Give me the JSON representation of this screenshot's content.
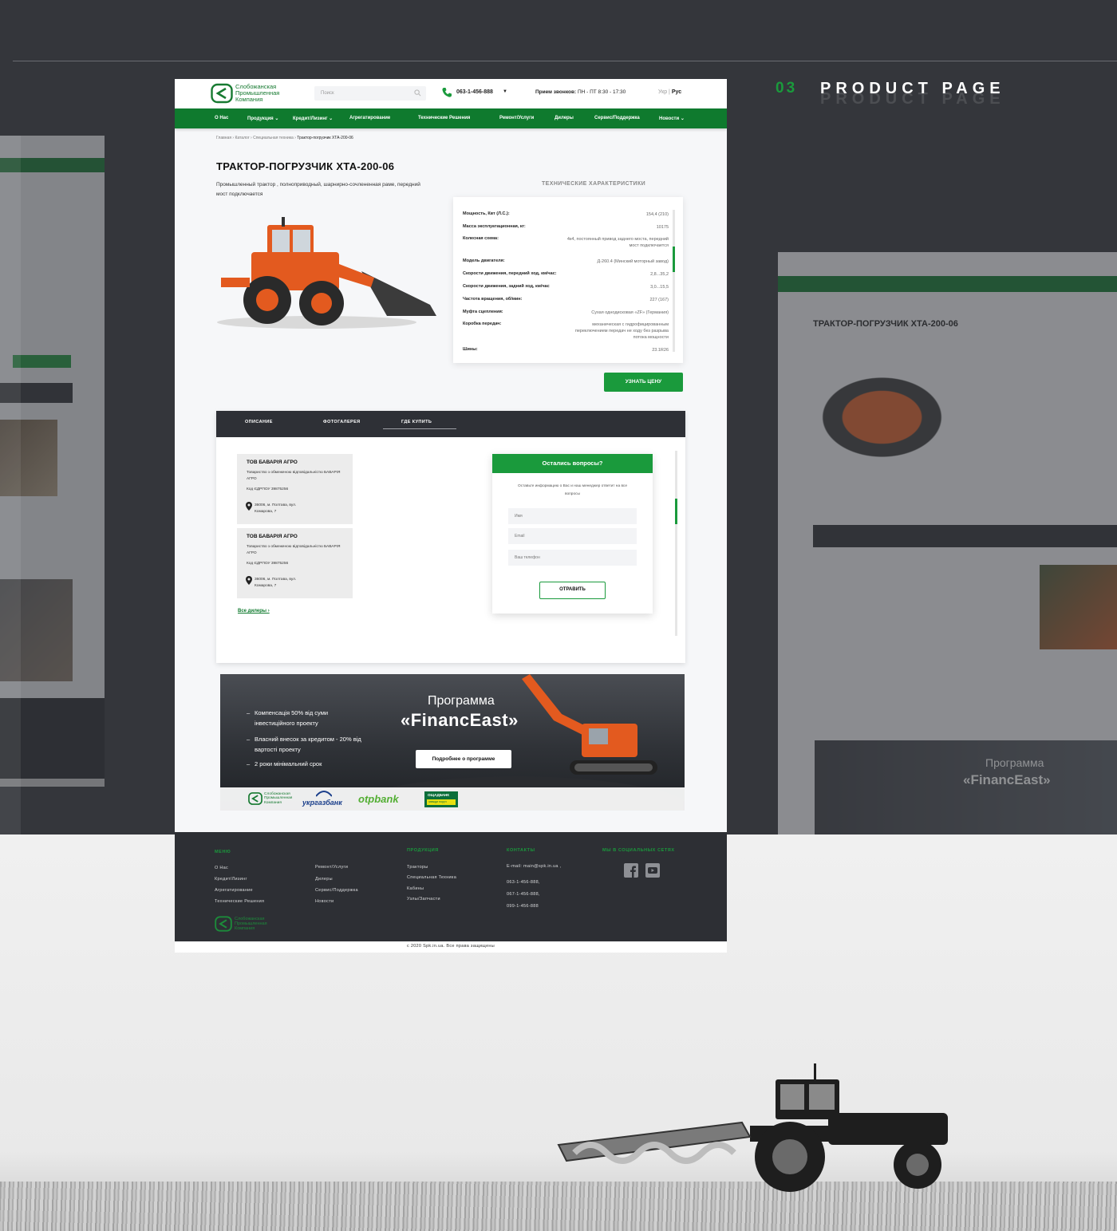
{
  "presentation": {
    "section_number": "03",
    "section_title": "PRODUCT PAGE"
  },
  "header": {
    "logo_text": [
      "Слобожанская",
      "Промышленная",
      "Компания"
    ],
    "search_placeholder": "Поиск",
    "phone": "063-1-456-888",
    "hours_label": "Прием звонков:",
    "hours_value": "ПН - ПТ  8:30 - 17:30",
    "lang_ukr": "Укр",
    "lang_sep": "|",
    "lang_rus": "Рус"
  },
  "nav": {
    "items": [
      "О Нас",
      "Продукция",
      "Кредит/Лизинг",
      "Агрегатирование",
      "Технические Решения",
      "Ремонт/Услуги",
      "Дилеры",
      "Сервис/Поддержка",
      "Новости"
    ]
  },
  "breadcrumbs": {
    "trail": "Главная  ›  Каталог  ›  Специальная техника  ›",
    "current": "Трактор-погрузчик ХТА-200-06"
  },
  "product": {
    "title": "ТРАКТОР-ПОГРУЗЧИК ХТА-200-06",
    "subtitle": "Промышленный трактор , полноприводный, шарнирно-сочлененная  раме, передний мост подключается",
    "specs_heading": "ТЕХНИЧЕСКИЕ ХАРАКТЕРИСТИКИ",
    "specs": [
      {
        "key": "Мощность, Квт (Л.С.):",
        "value": "154,4 (210)"
      },
      {
        "key": "Масса эксплуатационная, кг:",
        "value": "10175"
      },
      {
        "key": "Колесная схема:",
        "value": "4к4, постоянный привод заднего моста, передний мост подключается"
      },
      {
        "key": "Модель двигателя:",
        "value": "Д-260.4 (Минский моторный завод)"
      },
      {
        "key": "Скорости движения, передний ход, км/час:",
        "value": "2,8...35,2"
      },
      {
        "key": "Скорости движения, задний ход, км/час",
        "value": "3,0...15,5"
      },
      {
        "key": "Частота вращения, об/мин:",
        "value": "227 (167)"
      },
      {
        "key": "Муфта сцепления:",
        "value": "Сухая однодисковая «ZF» (Германия)"
      },
      {
        "key": "Коробка передач:",
        "value": "механическая с гидрофицированным переключением передач не ходу без разрыва потока мощности"
      },
      {
        "key": "Шины:",
        "value": "23.1R26"
      }
    ],
    "price_button": "УЗНАТЬ ЦЕНУ"
  },
  "tabs": {
    "items": [
      "ОПИСАНИЕ",
      "ФОТОГАЛЕРЕЯ",
      "ГДЕ КУПИТЬ"
    ],
    "active": "ГДЕ КУПИТЬ"
  },
  "dealers": [
    {
      "name": "ТОВ БАВАРІЯ АГРО",
      "desc": "Товариство з обмеженою відповідальністю БАВАРІЯ АГРО",
      "code": "Код ЄДРПОУ  39875256",
      "address": "36006, м. Полтава, вул. Комарова, 7"
    },
    {
      "name": "ТОВ БАВАРІЯ АГРО",
      "desc": "Товариство з обмеженою відповідальністю БАВАРІЯ АГРО",
      "code": "Код ЄДРПОУ  39875256",
      "address": "36006, м. Полтава, вул. Комарова, 7"
    }
  ],
  "all_dealers": "Все дилеры  ›",
  "question_form": {
    "title": "Остались вопросы?",
    "text": "Оставьте информацию о Вас и наш менеджер ответит на все вопросы",
    "name_placeholder": "Имя",
    "email_placeholder": "Email",
    "phone_placeholder": "Ваш телефон",
    "submit": "ОТРАВИТЬ"
  },
  "banner": {
    "bullets": [
      "Компенсація 50% від суми інвестиційного проекту",
      "Власний внесок за кредитом - 20% від вартості проекту",
      "2 роки мінімальний срок"
    ],
    "title_line1": "Программа",
    "title_line2": "«FinancEast»",
    "button": "Подробнее о программе",
    "partners": {
      "ukrgasbank": "укргазбанк",
      "otp": "otpbank",
      "oschadbank": "ОЩАДБАНК",
      "oschadbank_tag": "завжди поруч"
    }
  },
  "footer": {
    "menu_heading": "МЕНЮ",
    "menu_col1": [
      "О Нас",
      "Кредит/Лизинг",
      "Агрегатирование",
      "Технические Решения"
    ],
    "menu_col2": [
      "Ремонт/Услуги",
      "Дилеры",
      "Сервис/Поддержка",
      "Новости"
    ],
    "products_heading": "ПРОДУКЦИЯ",
    "products": [
      "Тракторы",
      "Специальная Техника",
      "Кабины",
      "Узлы/Запчасти"
    ],
    "contacts_heading": "КОНТАКТЫ",
    "email": "E-mail:  main@spk.in.ua ,",
    "phones": [
      "063-1-456-888,",
      "067-1-456-888,",
      "099-1-456-888"
    ],
    "social_heading": "МЫ В СОЦИАЛЬНЫХ СЕТЯХ",
    "copyright": "с 2020 Spk.in.ua. Все права защищены"
  },
  "ghost_right": {
    "title": "ТРАКТОР-ПОГРУЗЧИК ХТА-200-06",
    "banner_title_line1": "Программа",
    "banner_title_line2": "«FinancEast»"
  },
  "colors": {
    "brand_green": "#0f7a2e",
    "accent_green": "#1a9a3c",
    "dark": "#2e3036",
    "backdrop": "#34363b"
  }
}
